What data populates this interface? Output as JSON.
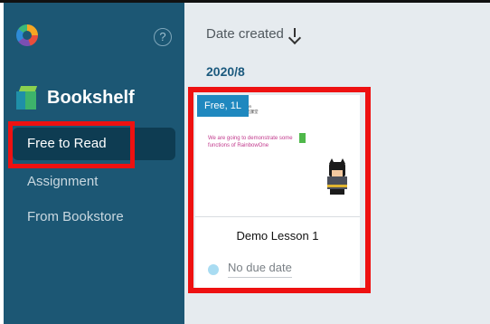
{
  "sidebar": {
    "app_logo_icon": "rainbowone-logo-icon",
    "help_glyph": "?",
    "title": "Bookshelf",
    "items": [
      {
        "label": "Free to Read",
        "selected": true
      },
      {
        "label": "Assignment",
        "selected": false
      },
      {
        "label": "From Bookstore",
        "selected": false
      }
    ]
  },
  "main": {
    "sort_label": "Date created",
    "group_date": "2020/8",
    "card": {
      "badge": "Free, 1L",
      "cover_line1": "is a Demo Lesson",
      "cover_line2": "範例一課堂一師示範課堂",
      "cover_note": "We are going to demonstrate some functions of RainbowOne",
      "title": "Demo Lesson 1",
      "due": "No due date"
    }
  },
  "colors": {
    "sidebar": "#1c5774",
    "selected_item": "#0e3c52",
    "main_bg": "#e6ebef",
    "badge": "#1f88bf",
    "highlight": "#ee1111"
  }
}
